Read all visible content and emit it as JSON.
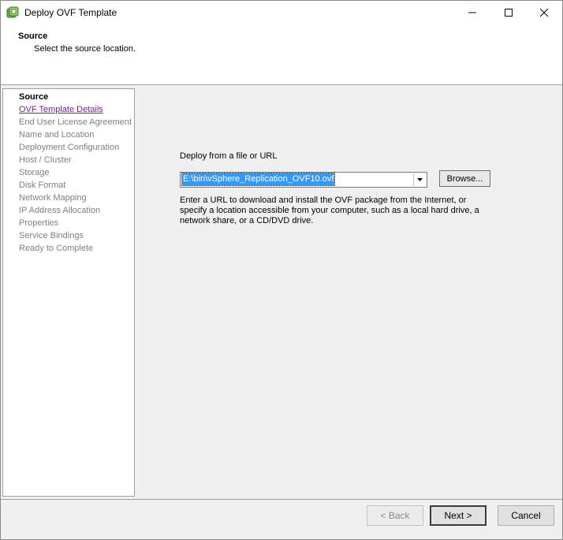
{
  "window": {
    "title": "Deploy OVF Template",
    "icon": "vsphere-deploy-icon"
  },
  "header": {
    "title": "Source",
    "subtitle": "Select the source location."
  },
  "steps": [
    {
      "label": "Source",
      "state": "current"
    },
    {
      "label": "OVF Template Details",
      "state": "link"
    },
    {
      "label": "End User License Agreement",
      "state": "disabled"
    },
    {
      "label": "Name and Location",
      "state": "disabled"
    },
    {
      "label": "Deployment Configuration",
      "state": "disabled"
    },
    {
      "label": "Host / Cluster",
      "state": "disabled"
    },
    {
      "label": "Storage",
      "state": "disabled"
    },
    {
      "label": "Disk Format",
      "state": "disabled"
    },
    {
      "label": "Network Mapping",
      "state": "disabled"
    },
    {
      "label": "IP Address Allocation",
      "state": "disabled"
    },
    {
      "label": "Properties",
      "state": "disabled"
    },
    {
      "label": "Service Bindings",
      "state": "disabled"
    },
    {
      "label": "Ready to Complete",
      "state": "disabled"
    }
  ],
  "main": {
    "deploy_label": "Deploy from a file or URL",
    "source_value": "E:\\bin\\vSphere_Replication_OVF10.ovf",
    "browse_label": "Browse...",
    "description": "Enter a URL to download and install the OVF package from the Internet, or specify a location accessible from your computer, such as a local hard drive, a network share, or a CD/DVD drive."
  },
  "footer": {
    "back_label": "< Back",
    "next_label": "Next >",
    "cancel_label": "Cancel"
  },
  "colors": {
    "selection": "#3399ff",
    "visited_link": "#7b1fa2",
    "disabled_text": "#808080"
  }
}
